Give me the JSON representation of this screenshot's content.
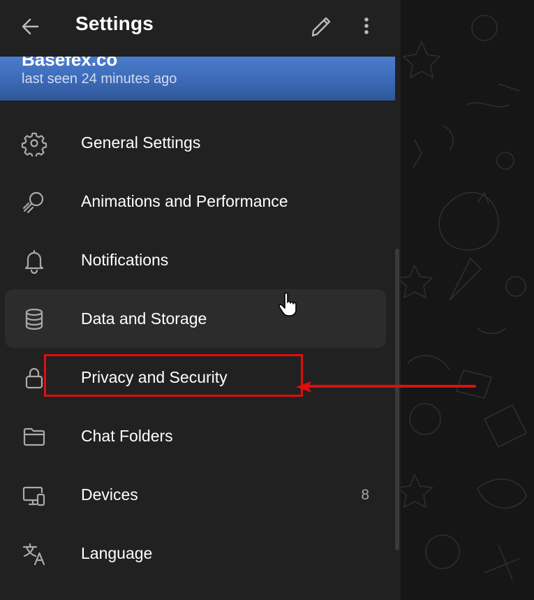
{
  "header": {
    "title": "Settings"
  },
  "profile": {
    "name": "Basefex.co",
    "status": "last seen 24 minutes ago"
  },
  "menu": {
    "items": [
      {
        "label": "General Settings",
        "icon": "gear-icon"
      },
      {
        "label": "Animations and Performance",
        "icon": "animations-icon"
      },
      {
        "label": "Notifications",
        "icon": "bell-icon"
      },
      {
        "label": "Data and Storage",
        "icon": "database-icon"
      },
      {
        "label": "Privacy and Security",
        "icon": "lock-icon"
      },
      {
        "label": "Chat Folders",
        "icon": "folder-icon"
      },
      {
        "label": "Devices",
        "icon": "devices-icon",
        "count": "8"
      },
      {
        "label": "Language",
        "icon": "translate-icon"
      }
    ]
  },
  "colors": {
    "panel": "#212121",
    "accent": "#3d6ab7",
    "annotation": "#e20d0d"
  }
}
